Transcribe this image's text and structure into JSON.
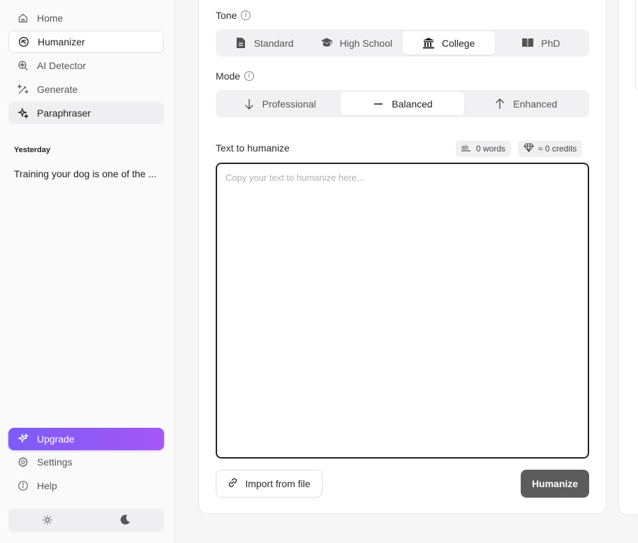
{
  "sidebar": {
    "items": [
      {
        "label": "Home",
        "icon": "home-icon"
      },
      {
        "label": "Humanizer",
        "icon": "humanizer-icon"
      },
      {
        "label": "AI Detector",
        "icon": "ai-detector-icon"
      },
      {
        "label": "Generate",
        "icon": "generate-icon"
      },
      {
        "label": "Paraphraser",
        "icon": "sparkles-icon"
      }
    ],
    "section_label": "Yesterday",
    "history": [
      "Training your dog is one of the ..."
    ],
    "upgrade_label": "Upgrade",
    "settings_label": "Settings",
    "help_label": "Help",
    "accent_gradient": [
      "#7b5cf5",
      "#a557f7"
    ]
  },
  "tone": {
    "label": "Tone",
    "options": [
      "Standard",
      "High School",
      "College",
      "PhD"
    ],
    "selected": "College"
  },
  "mode": {
    "label": "Mode",
    "options": [
      "Professional",
      "Balanced",
      "Enhanced"
    ],
    "selected": "Balanced"
  },
  "editor": {
    "label": "Text to humanize",
    "words_badge": "0 words",
    "credits_badge": "≈ 0 credits",
    "placeholder": "Copy your text to humanize here..."
  },
  "actions": {
    "import_label": "Import from file",
    "humanize_label": "Humanize"
  }
}
